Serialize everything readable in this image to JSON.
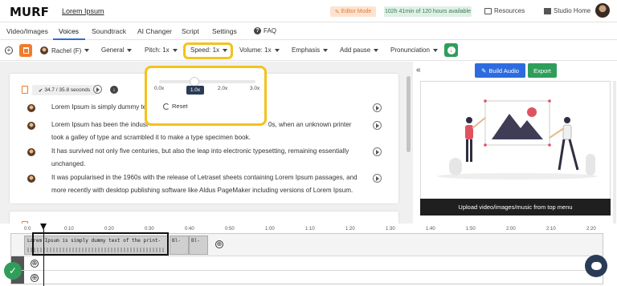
{
  "header": {
    "logo": "MURF",
    "project_name": "Lorem Ipsum",
    "editor_mode": "Editor Mode",
    "time_available": "102h 41min of 120 hours available",
    "resources": "Resources",
    "studio_home": "Studio Home"
  },
  "tabs": [
    {
      "label": "Video/Images"
    },
    {
      "label": "Voices"
    },
    {
      "label": "Soundtrack"
    },
    {
      "label": "AI Changer"
    },
    {
      "label": "Script"
    },
    {
      "label": "Settings"
    }
  ],
  "faq": "FAQ",
  "toolbar": {
    "voice": "Rachel (F)",
    "style": "General",
    "pitch": "Pitch: 1x",
    "speed": "Speed: 1x",
    "volume": "Volume: 1x",
    "emphasis": "Emphasis",
    "add_pause": "Add pause",
    "pronunciation": "Pronunciation"
  },
  "block": {
    "duration": "34.7 / 35.8 seconds",
    "lines": [
      "Lorem Ipsum is simply dummy te",
      "Lorem Ipsum has been the indust",
      "took a galley of type and scrambled it to make a type specimen book.",
      "It has survived not only five centuries, but also the leap into electronic typesetting, remaining essentially",
      "unchanged.",
      "It was popularised in the 1960s with the release of Letraset sheets containing Lorem Ipsum passages, and",
      "more recently with desktop publishing software like Aldus PageMaker including versions of Lorem Ipsum."
    ],
    "line2_tail": "0s, when an unknown printer"
  },
  "speed_popup": {
    "min_label": "0.0x",
    "mid_label": "2.0x",
    "max_label": "3.0x",
    "value_label": "1.0x",
    "value": 1.0,
    "reset": "Reset"
  },
  "right_panel": {
    "build_audio": "Build Audio",
    "export": "Export",
    "preview_caption": "Upload video/images/music from top menu"
  },
  "timeline": {
    "ticks": [
      "0:0",
      "0:10",
      "0:20",
      "0:30",
      "0:40",
      "0:50",
      "1:00",
      "1:10",
      "1:20",
      "1:30",
      "1:40",
      "1:50",
      "2:00",
      "2:10",
      "2:20"
    ],
    "clip1_text": "Lorem Ipsum is simply dummy text of the print-",
    "clip2_text": "Bl-",
    "clip3_text": "Bl-"
  },
  "colors": {
    "accent_blue": "#2d6cdf",
    "green": "#2f9e5b",
    "orange": "#f07c2c",
    "highlight_yellow": "#f4c21b",
    "navy": "#2a3b56"
  },
  "icons": [
    "trash-icon",
    "plus-circle-icon",
    "download-icon",
    "play-icon",
    "reset-icon",
    "help-icon",
    "book-icon",
    "home-icon",
    "collapse-icon",
    "build-audio-icon",
    "check-icon",
    "chat-icon"
  ]
}
